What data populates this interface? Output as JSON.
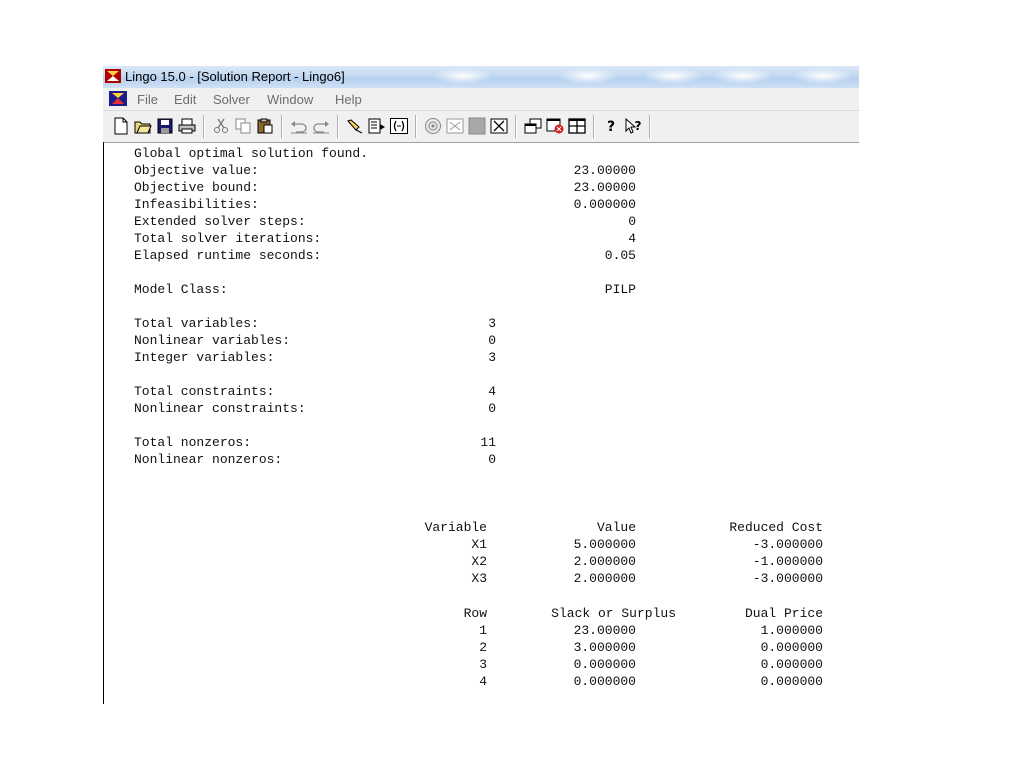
{
  "window": {
    "title": "Lingo 15.0 - [Solution Report - Lingo6]"
  },
  "menu": {
    "items": [
      "File",
      "Edit",
      "Solver",
      "Window",
      "Help"
    ]
  },
  "toolbar": {
    "buttons": [
      "new-icon",
      "open-icon",
      "save-icon",
      "print-icon",
      "cut-icon",
      "copy-icon",
      "paste-icon",
      "undo-icon",
      "redo-icon",
      "find-icon",
      "goto-line-icon",
      "match-parenthesis-icon",
      "solve-icon",
      "solution-icon",
      "stop-icon",
      "close-all-icon",
      "send-to-back-icon",
      "close-window-icon",
      "tile-icon",
      "help-icon",
      "context-help-icon"
    ]
  },
  "report": {
    "status_line": "Global optimal solution found.",
    "summary": [
      {
        "label": "Objective value:",
        "value": "23.00000"
      },
      {
        "label": "Objective bound:",
        "value": "23.00000"
      },
      {
        "label": "Infeasibilities:",
        "value": "0.000000"
      },
      {
        "label": "Extended solver steps:",
        "value": "0"
      },
      {
        "label": "Total solver iterations:",
        "value": "4"
      },
      {
        "label": "Elapsed runtime seconds:",
        "value": "0.05"
      }
    ],
    "model_class": {
      "label": "Model Class:",
      "value": "PILP"
    },
    "variables": [
      {
        "label": "Total variables:",
        "value": "3"
      },
      {
        "label": "Nonlinear variables:",
        "value": "0"
      },
      {
        "label": "Integer variables:",
        "value": "3"
      }
    ],
    "constraints": [
      {
        "label": "Total constraints:",
        "value": "4"
      },
      {
        "label": "Nonlinear constraints:",
        "value": "0"
      }
    ],
    "nonzeros": [
      {
        "label": "Total nonzeros:",
        "value": "11"
      },
      {
        "label": "Nonlinear nonzeros:",
        "value": "0"
      }
    ],
    "variable_table": {
      "headers": [
        "Variable",
        "Value",
        "Reduced Cost"
      ],
      "rows": [
        [
          "X1",
          "5.000000",
          "-3.000000"
        ],
        [
          "X2",
          "2.000000",
          "-1.000000"
        ],
        [
          "X3",
          "2.000000",
          "-3.000000"
        ]
      ]
    },
    "row_table": {
      "headers": [
        "Row",
        "Slack or Surplus",
        "Dual Price"
      ],
      "rows": [
        [
          "1",
          "23.00000",
          "1.000000"
        ],
        [
          "2",
          "3.000000",
          "0.000000"
        ],
        [
          "3",
          "0.000000",
          "0.000000"
        ],
        [
          "4",
          "0.000000",
          "0.000000"
        ]
      ]
    }
  }
}
